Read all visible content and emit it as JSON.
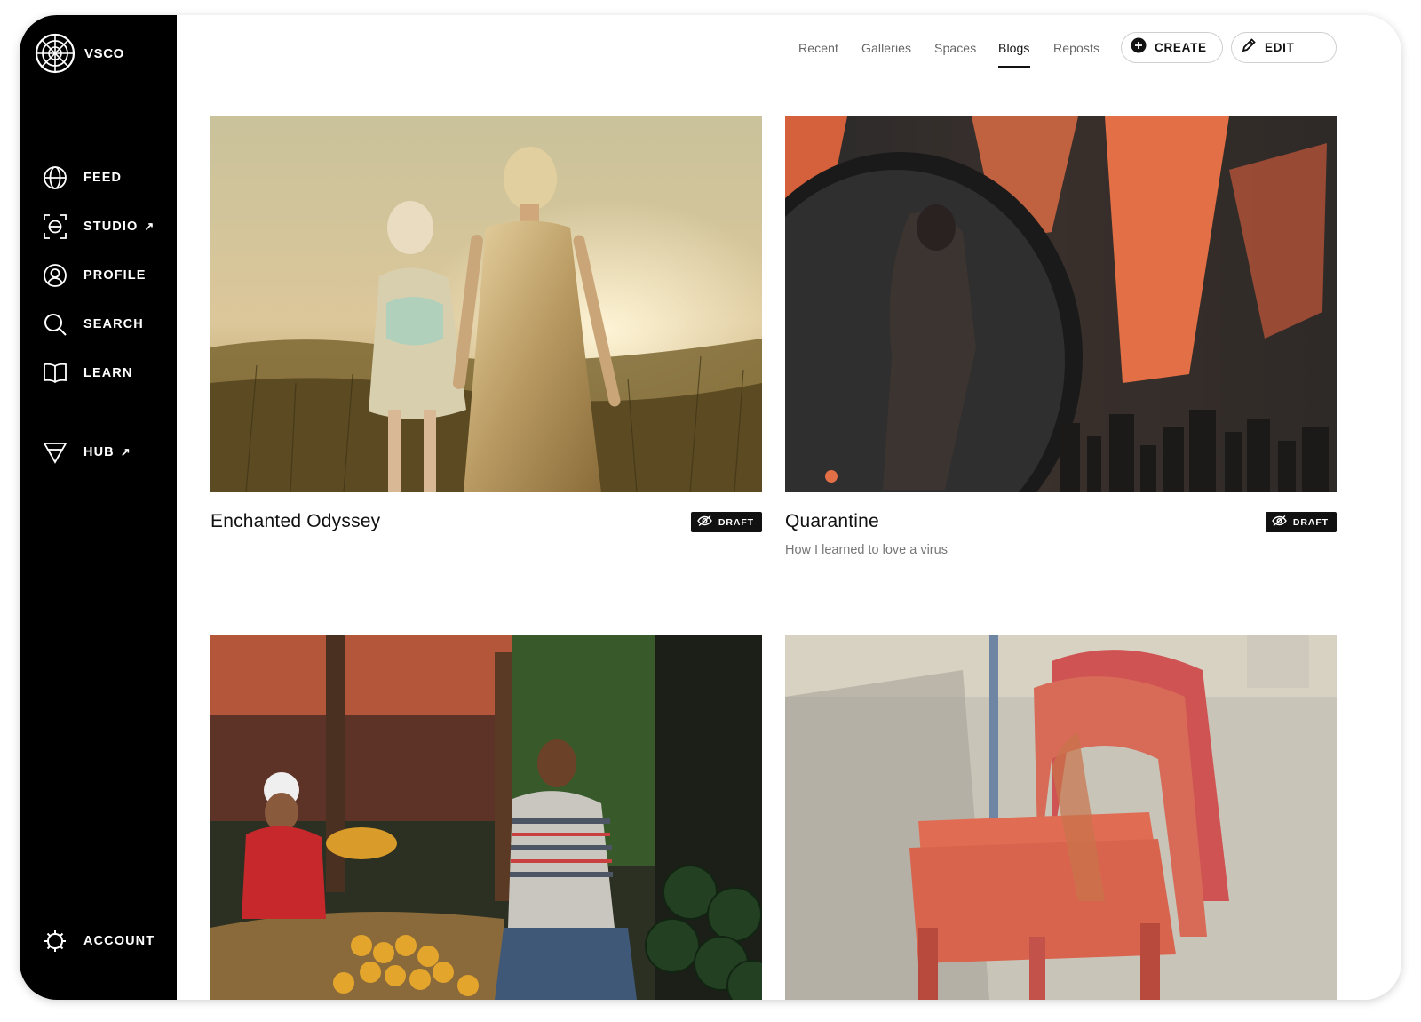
{
  "app": {
    "logo_text": "VSCO"
  },
  "sidebar": {
    "items": [
      {
        "label": "FEED",
        "icon": "globe-icon",
        "external": false
      },
      {
        "label": "STUDIO",
        "icon": "studio-icon",
        "external": true
      },
      {
        "label": "PROFILE",
        "icon": "profile-icon",
        "external": false
      },
      {
        "label": "SEARCH",
        "icon": "search-icon",
        "external": false
      },
      {
        "label": "LEARN",
        "icon": "book-icon",
        "external": false
      },
      {
        "label": "HUB",
        "icon": "triangle-icon",
        "external": true
      }
    ],
    "account_label": "ACCOUNT",
    "external_glyph": "↗"
  },
  "topnav": {
    "tabs": [
      "Recent",
      "Galleries",
      "Spaces",
      "Blogs",
      "Reposts"
    ],
    "active_tab": "Blogs",
    "create_label": "CREATE",
    "edit_label": "EDIT"
  },
  "blogs": [
    {
      "title": "Enchanted Odyssey",
      "subtitle": "",
      "badge": "DRAFT",
      "image": "two women walking in golden field at sunset"
    },
    {
      "title": "Quarantine",
      "subtitle": "How I learned to love a virus",
      "badge": "DRAFT",
      "image": "mirror with orange light shadows"
    },
    {
      "title": "",
      "subtitle": "",
      "badge": "",
      "image": "market vendors with fruit"
    },
    {
      "title": "",
      "subtitle": "",
      "badge": "",
      "image": "stacked red plastic chairs"
    }
  ],
  "colors": {
    "sidebar_bg": "#000000",
    "text": "#111111",
    "muted": "#777777"
  }
}
